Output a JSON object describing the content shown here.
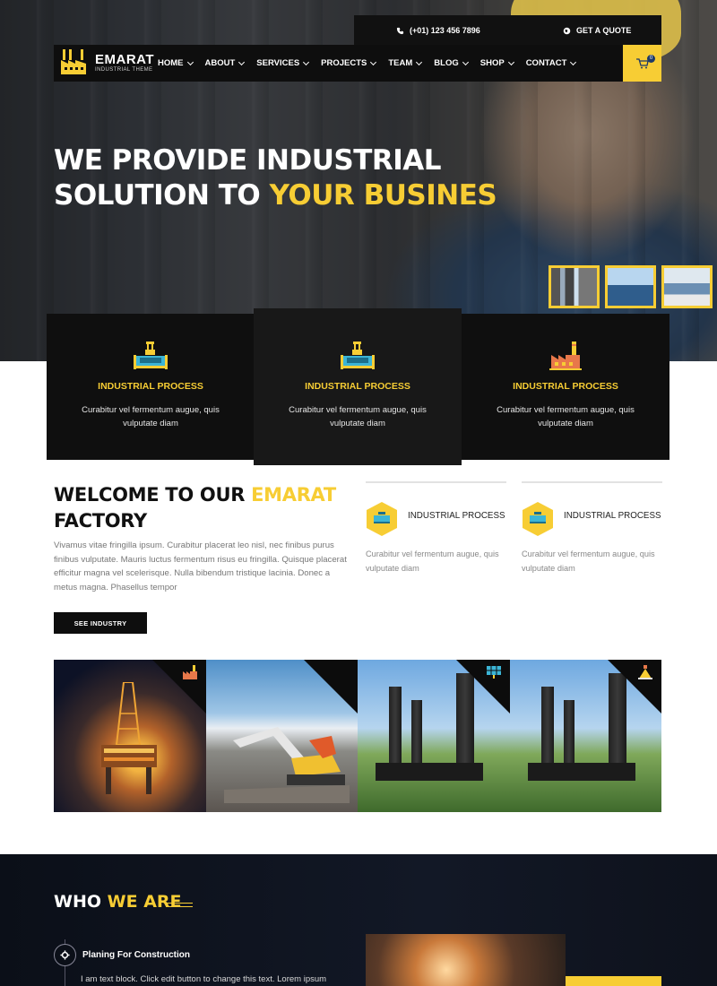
{
  "topbar": {
    "phone": "(+01) 123 456 7896",
    "quote": "GET A QUOTE"
  },
  "brand": {
    "name": "EMARAT",
    "tagline": "INDUSTRIAL THEME"
  },
  "nav": {
    "items": [
      {
        "label": "HOME"
      },
      {
        "label": "ABOUT"
      },
      {
        "label": "SERVICES"
      },
      {
        "label": "PROJECTS"
      },
      {
        "label": "TEAM"
      },
      {
        "label": "BLOG"
      },
      {
        "label": "SHOP"
      },
      {
        "label": "CONTACT"
      }
    ],
    "cart_count": "0"
  },
  "hero": {
    "line1": "WE PROVIDE INDUSTRIAL",
    "line2_plain": "SOLUTION TO ",
    "line2_highlight": "YOUR BUSINES"
  },
  "feature_cards": [
    {
      "title": "INDUSTRIAL PROCESS",
      "text": "Curabitur vel fermentum augue, quis vulputate diam",
      "icon": "machine-icon"
    },
    {
      "title": "INDUSTRIAL PROCESS",
      "text": "Curabitur vel fermentum augue, quis vulputate diam",
      "icon": "machine-icon"
    },
    {
      "title": "INDUSTRIAL PROCESS",
      "text": "Curabitur vel fermentum augue, quis vulputate diam",
      "icon": "factory-icon"
    }
  ],
  "welcome": {
    "title_plain": "WELCOME TO OUR ",
    "title_highlight": "EMARAT",
    "title_line2": "FACTORY",
    "body": "Vivamus vitae fringilla ipsum. Curabitur placerat leo nisl, nec finibus purus finibus vulputate. Mauris luctus fermentum risus eu fringilla. Quisque placerat efficitur magna vel scelerisque. Nulla bibendum tristique lacinia. Donec a metus magna. Phasellus tempor",
    "button": "SEE INDUSTRY"
  },
  "mini_features": [
    {
      "title": "INDUSTRIAL PROCESS",
      "text": "Curabitur vel fermentum augue, quis vulputate diam"
    },
    {
      "title": "INDUSTRIAL PROCESS",
      "text": "Curabitur vel fermentum augue, quis vulputate diam"
    }
  ],
  "gallery": [
    {
      "subject": "oil-rig",
      "icon": "factory-icon"
    },
    {
      "subject": "excavator-demolition",
      "icon": "none"
    },
    {
      "subject": "steel-pillars",
      "icon": "solar-panel-icon"
    },
    {
      "subject": "steel-pillars",
      "icon": "hazard-icon"
    }
  ],
  "who": {
    "title_plain": "WHO ",
    "title_highlight": "WE ARE",
    "step_title": "Planing For Construction",
    "step_text": "I am text block. Click edit button to change this text. Lorem ipsum"
  },
  "colors": {
    "accent": "#f7cd34",
    "dark": "#0e0e0e",
    "icon_teal": "#3bb5d6",
    "icon_orange": "#e8784a"
  }
}
